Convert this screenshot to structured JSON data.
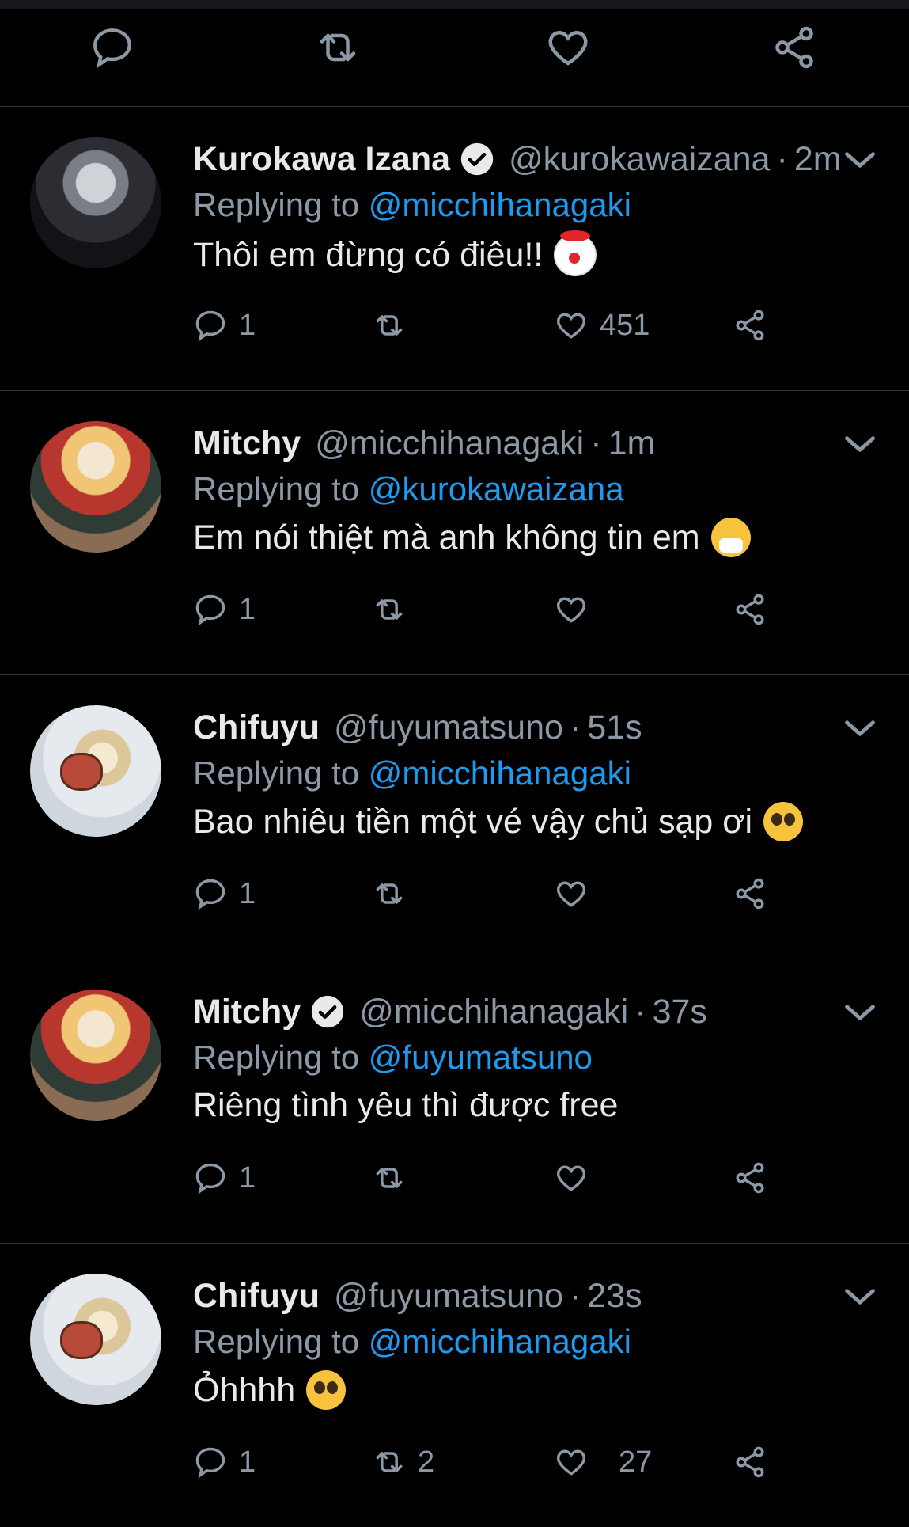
{
  "tweets": [
    {
      "name": "Kurokawa Izana",
      "verified": true,
      "handle": "@kurokawaizana",
      "time": "2m",
      "reply_prefix": "Replying to",
      "reply_to": "@micchihanagaki",
      "text": "Thôi em đừng có điêu!!",
      "emoji": "clown-emoji",
      "replies": "1",
      "retweets": "",
      "likes": "451"
    },
    {
      "name": "Mitchy",
      "verified": false,
      "handle": "@micchihanagaki",
      "time": "1m",
      "reply_prefix": "Replying to",
      "reply_to": "@kurokawaizana",
      "text": "Em nói thiệt mà anh không tin em",
      "emoji": "sneezing-face-emoji",
      "replies": "1",
      "retweets": "",
      "likes": ""
    },
    {
      "name": "Chifuyu",
      "verified": false,
      "handle": "@fuyumatsuno",
      "time": "51s",
      "reply_prefix": "Replying to",
      "reply_to": "@micchihanagaki",
      "text": "Bao nhiêu tiền một vé vậy chủ sạp ơi",
      "emoji": "pleading-face-emoji",
      "replies": "1",
      "retweets": "",
      "likes": ""
    },
    {
      "name": "Mitchy",
      "verified": true,
      "handle": "@micchihanagaki",
      "time": "37s",
      "reply_prefix": "Replying to",
      "reply_to": "@fuyumatsuno",
      "text": "Riêng tình yêu thì được free",
      "emoji": "",
      "replies": "1",
      "retweets": "",
      "likes": ""
    },
    {
      "name": "Chifuyu",
      "verified": false,
      "handle": "@fuyumatsuno",
      "time": "23s",
      "reply_prefix": "Replying to",
      "reply_to": "@micchihanagaki",
      "text": "Ỏhhhh",
      "emoji": "pleading-face-emoji",
      "replies": "1",
      "retweets": "2",
      "likes": "27"
    }
  ],
  "top_actions": [
    "reply-icon",
    "retweet-icon",
    "like-icon",
    "share-icon"
  ],
  "dot": "·",
  "colors": {
    "background": "#000000",
    "accent": "#1d9bf0",
    "muted": "#8b98a5",
    "text": "#e7e9ea",
    "separator": "#2f3336"
  }
}
